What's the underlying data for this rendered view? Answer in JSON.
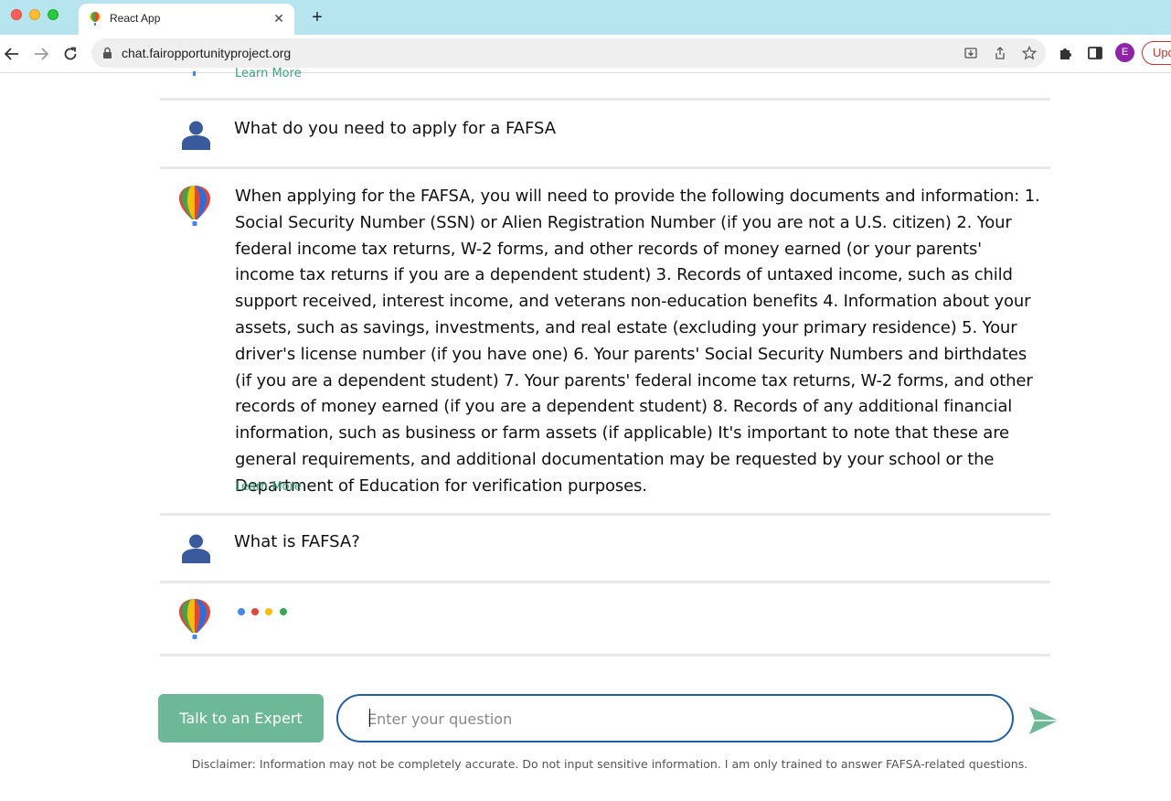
{
  "browser": {
    "tab_title": "React App",
    "tab_close": "✕",
    "new_tab": "+",
    "url": "chat.fairopportunityproject.org",
    "profile_initial": "E",
    "update_label": "Upd"
  },
  "chat": {
    "top_learn_more": "Learn More",
    "messages": [
      {
        "role": "user",
        "text": "What do you need to apply for a FAFSA"
      },
      {
        "role": "assistant",
        "text": "When applying for the FAFSA, you will need to provide the following documents and information: 1. Social Security Number (SSN) or Alien Registration Number (if you are not a U.S. citizen) 2. Your federal income tax returns, W-2 forms, and other records of money earned (or your parents' income tax returns if you are a dependent student) 3. Records of untaxed income, such as child support received, interest income, and veterans non-education benefits 4. Information about your assets, such as savings, investments, and real estate (excluding your primary residence) 5. Your driver's license number (if you have one) 6. Your parents' Social Security Numbers and birthdates (if you are a dependent student) 7. Your parents' federal income tax returns, W-2 forms, and other records of money earned (if you are a dependent student) 8. Records of any additional financial information, such as business or farm assets (if applicable) It's important to note that these are general requirements, and additional documentation may be requested by your school or the Department of Education for verification purposes.",
        "learn_more": "Learn More"
      },
      {
        "role": "user",
        "text": "What is FAFSA?"
      },
      {
        "role": "assistant",
        "loading": true
      }
    ]
  },
  "input": {
    "expert_button": "Talk to an Expert",
    "placeholder": "Enter your question",
    "value": ""
  },
  "disclaimer": "Disclaimer: Information may not be completely accurate. Do not input sensitive information. I am only trained to answer FAFSA-related questions.",
  "colors": {
    "accent_green": "#6db896",
    "link_green": "#3aa57f",
    "input_border": "#1f5fa8",
    "user_avatar": "#3a5a9e",
    "typing_dots": [
      "#4285f4",
      "#ea4335",
      "#fbbc05",
      "#34a853"
    ]
  },
  "icons": {
    "user_avatar": "person-icon",
    "bot_avatar": "balloon-logo",
    "send": "send-arrow-icon"
  }
}
